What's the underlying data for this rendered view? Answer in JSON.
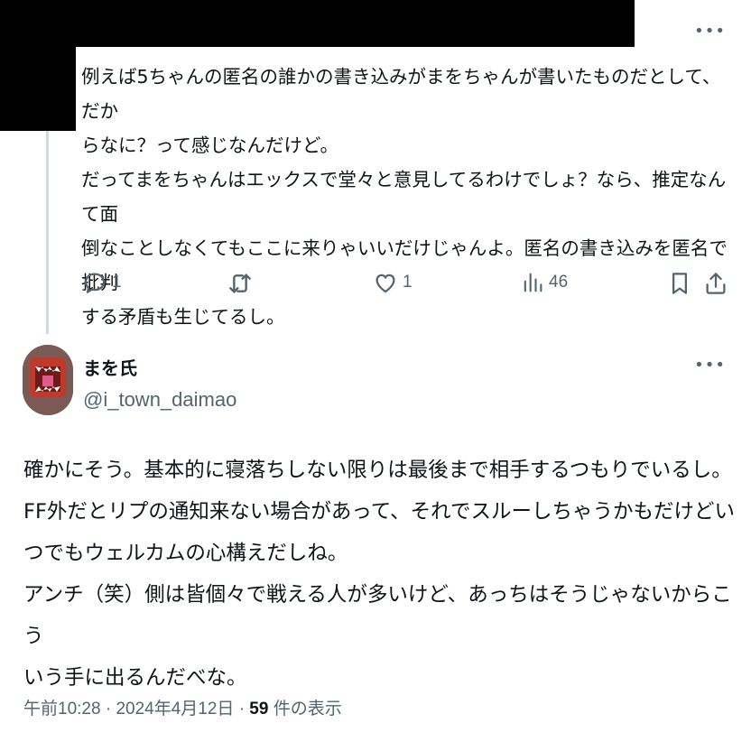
{
  "parent_tweet": {
    "more_label": "•••",
    "lines": [
      "例えば5ちゃんの匿名の誰かの書き込みがまをちゃんが書いたものだとして、だか",
      "らなに？って感じなんだけど。",
      "だってまをちゃんはエックスで堂々と意見してるわけでしょ？なら、推定なんて面",
      "倒なことしなくてもここに来りゃいいだけじゃんよ。匿名の書き込みを匿名で批判",
      "する矛盾も生じてるし。"
    ],
    "actions": {
      "reply_icon": "reply-icon",
      "reply_count": "1",
      "retweet_icon": "retweet-icon",
      "like_icon": "heart-icon",
      "like_count": "1",
      "views_icon": "views-icon",
      "views_count": "46",
      "bookmark_icon": "bookmark-icon",
      "share_icon": "share-icon"
    }
  },
  "reply_tweet": {
    "author": {
      "name": "まを氏",
      "handle": "@i_town_daimao",
      "avatar_icon": "avatar"
    },
    "more_label": "•••",
    "lines": [
      "確かにそう。基本的に寝落ちしない限りは最後まで相手するつもりでいるし。",
      "FF外だとリプの通知来ない場合があって、それでスルーしちゃうかもだけどい",
      "つでもウェルカムの心構えだしね。",
      "アンチ（笑）側は皆個々で戦える人が多いけど、あっちはそうじゃないからこう",
      "いう手に出るんだべな。"
    ],
    "meta": {
      "time": "午前10:28",
      "separator": "·",
      "date": "2024年4月12日",
      "views_count": "59",
      "views_label": "件の表示"
    }
  },
  "colors": {
    "text": "#0f1419",
    "secondary": "#536471",
    "thread_line": "#cfd9de",
    "redaction": "#000000"
  }
}
